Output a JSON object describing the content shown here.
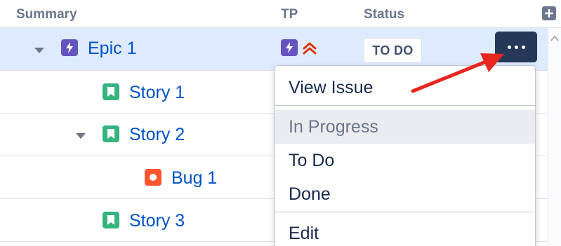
{
  "header": {
    "columns": [
      "Summary",
      "TP",
      "Status"
    ],
    "add_column_icon": "plus-square-icon"
  },
  "rows": [
    {
      "title": "Epic 1",
      "type": "epic",
      "icon": "lightning-icon",
      "expanded": true
    },
    {
      "title": "Story 1",
      "type": "story",
      "icon": "bookmark-icon"
    },
    {
      "title": "Story 2",
      "type": "story",
      "icon": "bookmark-icon",
      "expanded": true
    },
    {
      "title": "Bug 1",
      "type": "bug",
      "icon": "bug-icon"
    },
    {
      "title": "Story 3",
      "type": "story",
      "icon": "bookmark-icon"
    }
  ],
  "epic_row": {
    "tp_icon": "lightning-icon",
    "priority_icon": "highest-priority-icon",
    "status": "TO DO"
  },
  "menu": {
    "items": [
      "View Issue",
      "In Progress",
      "To Do",
      "Done",
      "Edit"
    ]
  },
  "colors": {
    "epic": "#6554c0",
    "story": "#36b37e",
    "bug": "#ff5630",
    "link": "#0052cc",
    "selected_row": "#deebff",
    "more_button": "#253858",
    "arrow": "#e8251f",
    "priority": "#de350b"
  }
}
